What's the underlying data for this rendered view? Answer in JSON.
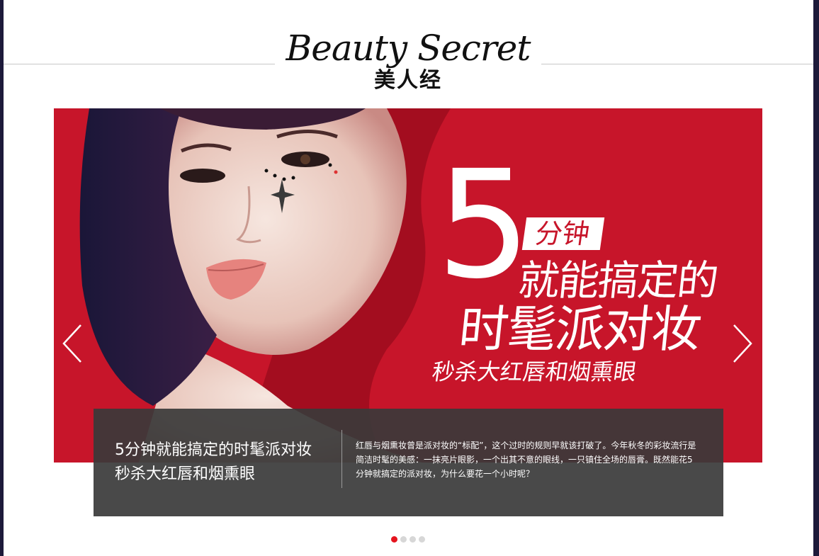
{
  "header": {
    "logo_en": "Beauty Secret",
    "logo_cn": "美人经"
  },
  "banner": {
    "big_number": "5",
    "tag": "分钟",
    "headline_line1": "就能搞定的",
    "headline_line2": "时髦派对妆",
    "headline_line3": "秒杀大红唇和烟熏眼",
    "prev_icon": "chevron-left-icon",
    "next_icon": "chevron-right-icon"
  },
  "caption": {
    "title": "5分钟就能搞定的时髦派对妆 秒杀大红唇和烟熏眼",
    "description": "红唇与烟熏妆曾是派对妆的“标配”，这个过时的规则早就该打破了。今年秋冬的彩妆流行是简洁时髦的美感：一抹亮片眼影，一个出其不意的眼线，一只镇住全场的唇膏。既然能花5分钟就搞定的派对妆，为什么要花一个小时呢？"
  },
  "pagination": {
    "count": 4,
    "active_index": 0
  },
  "colors": {
    "banner_red": "#c7152a",
    "active_dot": "#e5141e",
    "inactive_dot": "#d7d7d7"
  }
}
